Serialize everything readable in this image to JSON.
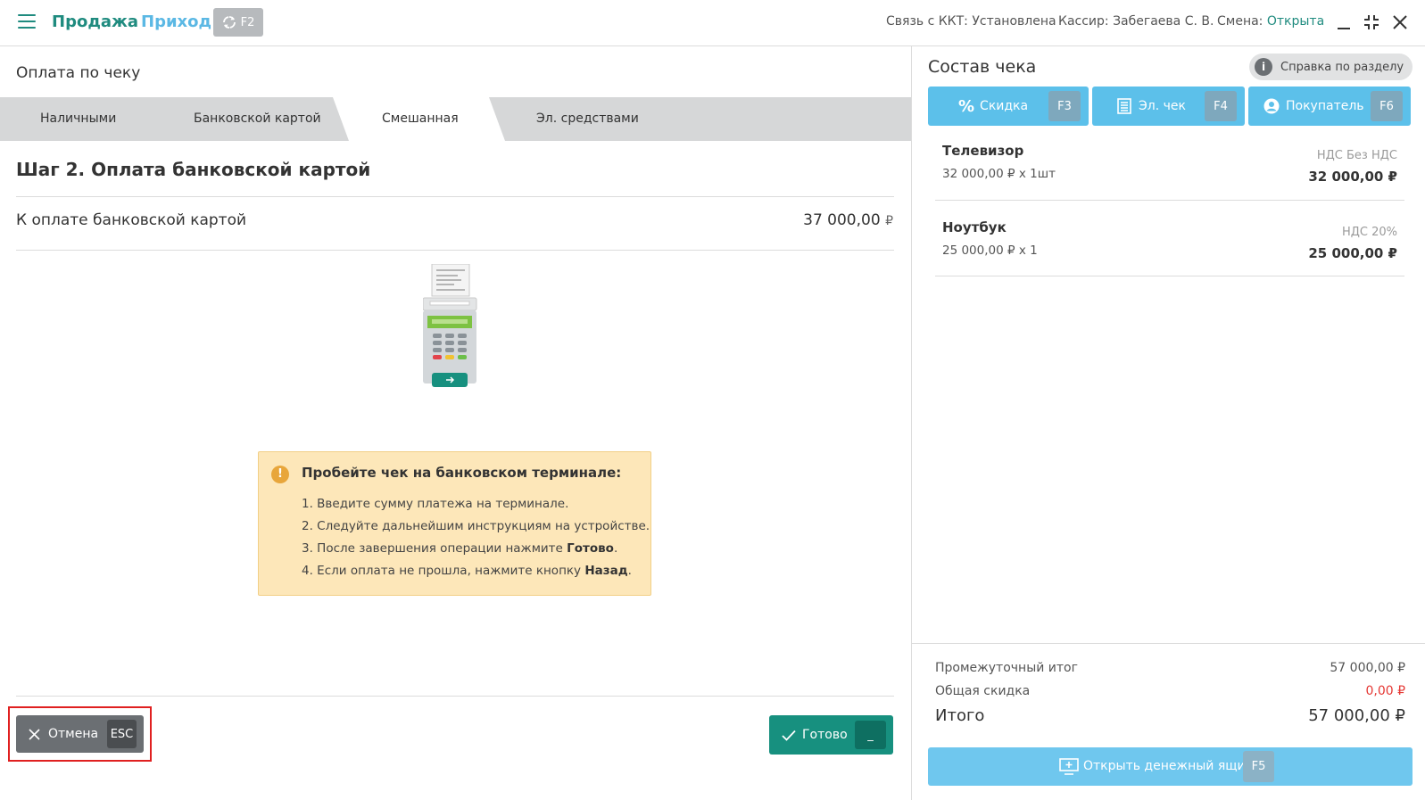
{
  "topbar": {
    "nav_sale": "Продажа",
    "nav_income": "Приход",
    "sync_key": "F2",
    "kkt_status": "Связь с ККТ: Установлена",
    "cashier": "Кассир: Забегаева С. В.",
    "shift_label": "Смена:",
    "shift_value": "Открыта",
    "accent_color": "#1f8b7f"
  },
  "payment": {
    "title": "Оплата по чеку",
    "tabs": [
      {
        "label": "Наличными",
        "active": false
      },
      {
        "label": "Банковской картой",
        "active": false
      },
      {
        "label": "Смешанная",
        "active": true
      },
      {
        "label": "Эл. средствами",
        "active": false
      }
    ],
    "step_title": "Шаг 2. Оплата банковской картой",
    "to_pay_label": "К оплате банковской картой",
    "to_pay_amount": "37 000,00",
    "currency": "₽",
    "notice": {
      "icon": "info-icon",
      "title": "Пробейте чек на банковском терминале:",
      "steps": [
        {
          "text": "1. Введите сумму платежа на терминале.",
          "bold": ""
        },
        {
          "text": "2. Следуйте дальнейшим инструкциям на устройстве.",
          "bold": ""
        },
        {
          "text": "3. После завершения операции нажмите ",
          "bold": "Готово",
          "end": "."
        },
        {
          "text": "4. Если оплата не прошла, нажмите кнопку ",
          "bold": "Назад",
          "end": "."
        }
      ]
    },
    "cancel_label": "Отмена",
    "cancel_key": "ESC",
    "done_label": "Готово",
    "done_key": "_"
  },
  "receipt": {
    "title": "Состав чека",
    "help_label": "Справка по разделу",
    "actions": [
      {
        "label": "Скидка",
        "key": "F3",
        "icon": "percent-icon"
      },
      {
        "label": "Эл. чек",
        "key": "F4",
        "icon": "receipt-icon"
      },
      {
        "label": "Покупатель",
        "key": "F6",
        "icon": "user-icon"
      }
    ],
    "items": [
      {
        "name": "Телевизор",
        "qty": "32 000,00 ₽ x 1шт",
        "vat": "НДС Без НДС",
        "sum": "32 000,00 ₽"
      },
      {
        "name": "Ноутбук",
        "qty": "25 000,00 ₽ x 1",
        "vat": "НДС 20%",
        "sum": "25 000,00 ₽"
      }
    ],
    "subtotal_label": "Промежуточный итог",
    "subtotal_value": "57 000,00 ₽",
    "discount_label": "Общая скидка",
    "discount_value": "0,00 ₽",
    "discount_color": "#e53935",
    "total_label": "Итого",
    "total_value": "57 000,00 ₽",
    "drawer_label": "Открыть денежный ящик",
    "drawer_key": "F5"
  }
}
